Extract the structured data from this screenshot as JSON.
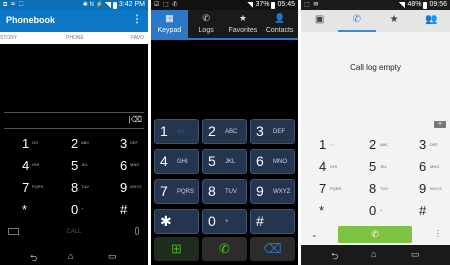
{
  "htc": {
    "status": {
      "icons": "⧉ ✉ ⬚",
      "right_icons": "✱ N ⚡",
      "time": "3:42 PM"
    },
    "appbar": {
      "title": "Phonebook",
      "menu": "⋮"
    },
    "tabs": [
      "STORY",
      "PHONE",
      "FAVO"
    ],
    "backspace": "|⌫",
    "keys": [
      {
        "d": "1",
        "l": "GO"
      },
      {
        "d": "2",
        "l": "ABC"
      },
      {
        "d": "3",
        "l": "DEF"
      },
      {
        "d": "4",
        "l": "GHI"
      },
      {
        "d": "5",
        "l": "JKL"
      },
      {
        "d": "6",
        "l": "MNO"
      },
      {
        "d": "7",
        "l": "PQRS"
      },
      {
        "d": "8",
        "l": "TUV"
      },
      {
        "d": "9",
        "l": "WXYZ"
      },
      {
        "d": "*",
        "l": ""
      },
      {
        "d": "0",
        "l": "+"
      },
      {
        "d": "#",
        "l": ""
      }
    ],
    "call_label": "CALL",
    "nav": [
      "⮌",
      "⌂",
      "▭"
    ]
  },
  "samsung": {
    "status": {
      "icons": "☑ ⬚ ✆",
      "battery": "37%",
      "time": "05:45"
    },
    "tabs": [
      {
        "label": "Keypad",
        "icon": "▦",
        "active": true
      },
      {
        "label": "Logs",
        "icon": "✆",
        "active": false
      },
      {
        "label": "Favorites",
        "icon": "★",
        "active": false
      },
      {
        "label": "Contacts",
        "icon": "👤",
        "active": false
      }
    ],
    "keys": [
      {
        "d": "1",
        "l": "◌◌"
      },
      {
        "d": "2",
        "l": "ABC"
      },
      {
        "d": "3",
        "l": "DEF"
      },
      {
        "d": "4",
        "l": "GHI"
      },
      {
        "d": "5",
        "l": "JKL"
      },
      {
        "d": "6",
        "l": "MNO"
      },
      {
        "d": "7",
        "l": "PQRS"
      },
      {
        "d": "8",
        "l": "TUV"
      },
      {
        "d": "9",
        "l": "WXYZ"
      },
      {
        "d": "✱",
        "l": ""
      },
      {
        "d": "0",
        "l": "+"
      },
      {
        "d": "#",
        "l": ""
      }
    ],
    "actions": [
      "⊞",
      "✆",
      "⌫"
    ],
    "colors": {
      "accent": "#2a78c8",
      "key_bg": "#23354f",
      "call_green": "#4fbd30"
    }
  },
  "sony": {
    "status": {
      "icons": "⬚ ✉",
      "battery": "48%",
      "time": "09:56"
    },
    "tabs": [
      "▣",
      "✆",
      "★",
      "👥"
    ],
    "empty_message": "Call log empty",
    "keys": [
      {
        "d": "1",
        "l": "◌◌"
      },
      {
        "d": "2",
        "l": "ABC"
      },
      {
        "d": "3",
        "l": "DEF"
      },
      {
        "d": "4",
        "l": "GHI"
      },
      {
        "d": "5",
        "l": "JKL"
      },
      {
        "d": "6",
        "l": "MNO"
      },
      {
        "d": "7",
        "l": "PQRS"
      },
      {
        "d": "8",
        "l": "TUV"
      },
      {
        "d": "9",
        "l": "WXYZ"
      },
      {
        "d": "*",
        "l": ""
      },
      {
        "d": "0",
        "l": "+"
      },
      {
        "d": "#",
        "l": ""
      }
    ],
    "chevron": "⌄",
    "call_icon": "✆",
    "more": "⋮",
    "nav": [
      "⮌",
      "⌂",
      "▭"
    ],
    "colors": {
      "accent": "#3b8ccf",
      "call_green": "#7dc242"
    }
  }
}
